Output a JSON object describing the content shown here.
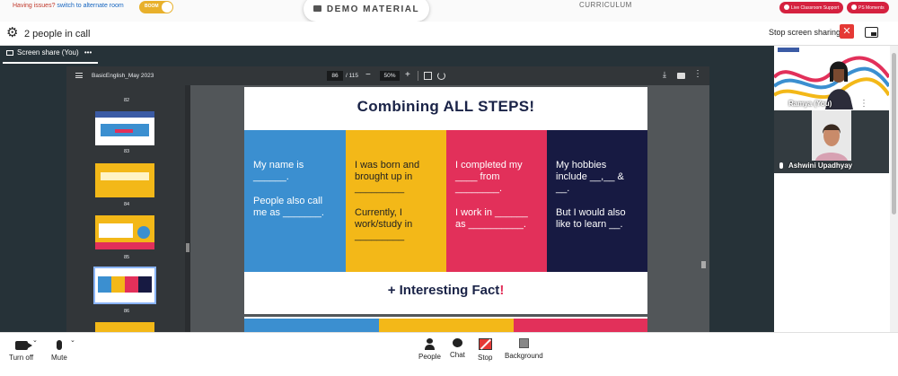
{
  "top_strip": {
    "issues_text": "Having issues?",
    "alternate_link": "switch to alternate room",
    "toggle_label": "BOOM",
    "demo_material": "DEMO MATERIAL",
    "curriculum": "CURRICULUM",
    "live_support": "Live Classroom Support",
    "ps_moments": "PS Moments"
  },
  "call_header": {
    "title": "2 people in call",
    "stop_screen_sharing": "Stop screen sharing",
    "stop_x": "✕"
  },
  "share_tab": {
    "label": "Screen share (You)",
    "more": "•••"
  },
  "pdf_viewer": {
    "file_name": "BasicEnglish_May 2023",
    "current_page": "86",
    "total_pages": "/ 115",
    "zoom": "50%",
    "zoom_out": "−",
    "zoom_in": "+",
    "download_icon": "⤓",
    "more_icon": "⋮"
  },
  "thumbnails": [
    {
      "page": "82",
      "colors": [
        "#ffffff",
        "#ffffff"
      ]
    },
    {
      "page": "83",
      "colors": [
        "#3b5ba5",
        "#e2305a"
      ]
    },
    {
      "page": "84",
      "colors": [
        "#f3b818",
        "#f3b818"
      ]
    },
    {
      "page": "85",
      "colors": [
        "#f3b818",
        "#e2305a"
      ]
    },
    {
      "page": "86",
      "colors": [
        "#3b8fd0",
        "#e2305a"
      ]
    }
  ],
  "slide": {
    "title": "Combining ALL STEPS!",
    "columns": [
      {
        "lines": [
          "My name is ______.",
          "People also call me as _______."
        ]
      },
      {
        "lines": [
          "I was born and brought up in _________",
          "Currently, I work/study in _________"
        ]
      },
      {
        "lines": [
          "I completed my ____ from ________.",
          "I work in ______ as __________."
        ]
      },
      {
        "lines": [
          "My hobbies include __,__ & __.",
          "But I would also like to learn __."
        ]
      }
    ],
    "fact_text": "+ Interesting Fact",
    "fact_excl": "!"
  },
  "participants": [
    {
      "name": "Ramya (You)"
    },
    {
      "name": "Ashwini Upadhyay"
    }
  ],
  "controls": {
    "turn_off": "Turn off",
    "mute": "Mute",
    "people": "People",
    "chat": "Chat",
    "stop": "Stop",
    "background": "Background"
  },
  "colors": {
    "accent_red": "#e53935",
    "toggle_yellow": "#e8b02b",
    "slide_blue": "#3b8fd0",
    "slide_yellow": "#f3b818",
    "slide_pink": "#e2305a",
    "slide_navy": "#171a42"
  }
}
